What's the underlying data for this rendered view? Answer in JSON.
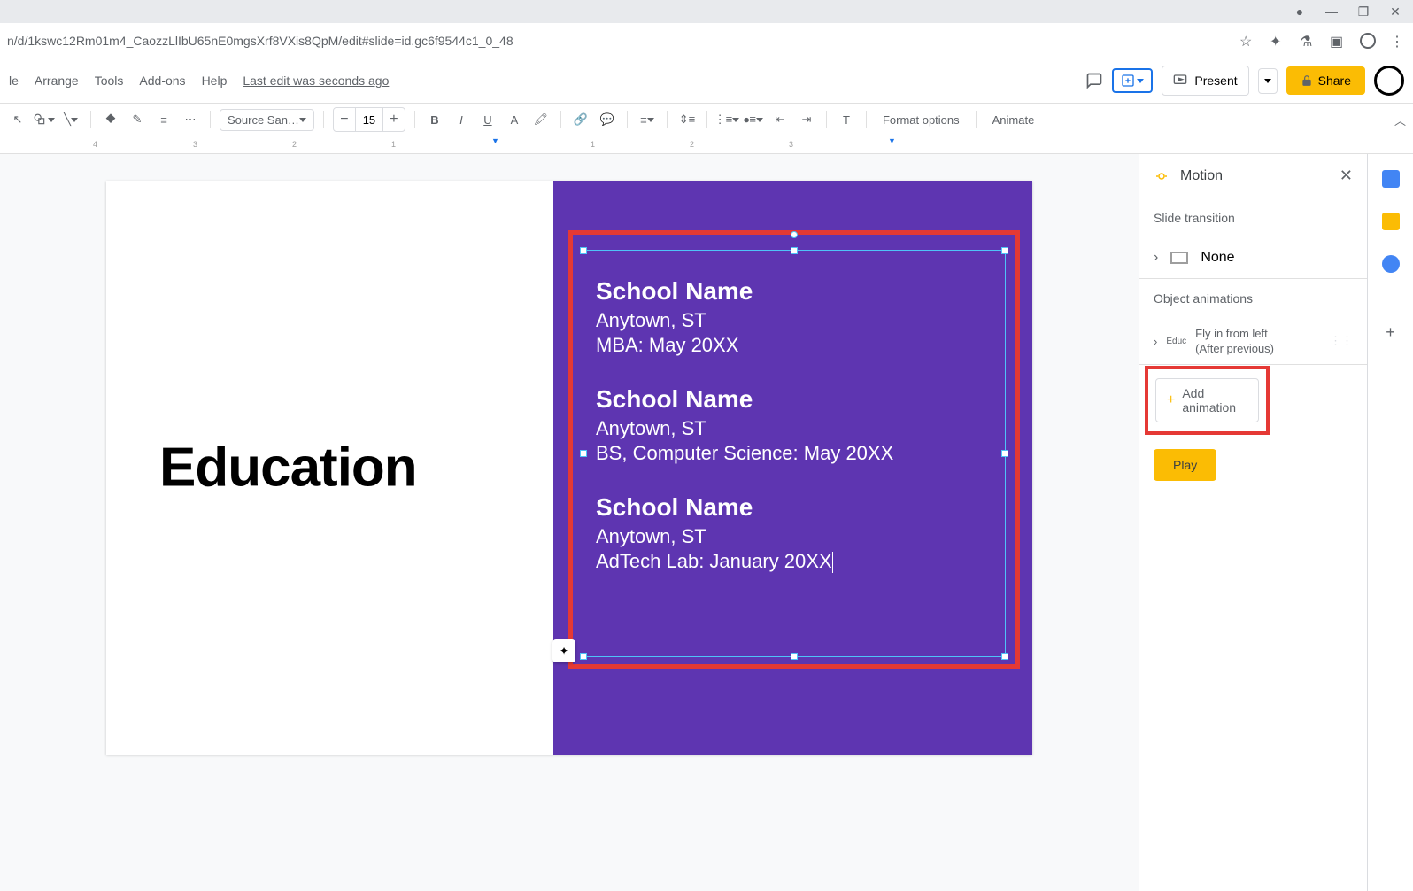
{
  "browser": {
    "url": "n/d/1kswc12Rm01m4_CaozzLlIbU65nE0mgsXrf8VXis8QpM/edit#slide=id.gc6f9544c1_0_48"
  },
  "menu": {
    "items": [
      "le",
      "Arrange",
      "Tools",
      "Add-ons",
      "Help"
    ],
    "last_edit": "Last edit was seconds ago",
    "present": "Present",
    "share": "Share"
  },
  "toolbar": {
    "font_name": "Source San…",
    "font_size": "15",
    "format_options": "Format options",
    "animate": "Animate"
  },
  "ruler": {
    "marks": [
      "4",
      "3",
      "2",
      "1",
      "1",
      "2",
      "3"
    ]
  },
  "slide": {
    "title": "Education",
    "schools": [
      {
        "name": "School Name",
        "location": "Anytown, ST",
        "degree": "MBA: May 20XX"
      },
      {
        "name": "School Name",
        "location": "Anytown, ST",
        "degree": "BS, Computer Science: May 20XX"
      },
      {
        "name": "School Name",
        "location": "Anytown, ST",
        "degree": "AdTech Lab: January 20XX"
      }
    ]
  },
  "motion": {
    "title": "Motion",
    "slide_transition_label": "Slide transition",
    "transition_value": "None",
    "object_animations_label": "Object animations",
    "animation": {
      "tag": "Educ",
      "effect": "Fly in from left",
      "timing": "(After previous)"
    },
    "add_animation": "Add animation",
    "play": "Play"
  }
}
